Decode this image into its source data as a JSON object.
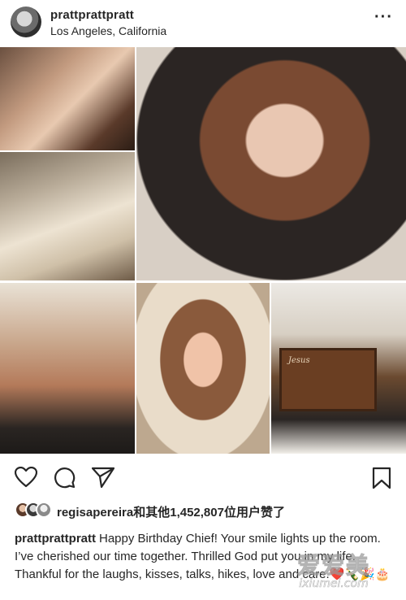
{
  "post": {
    "username": "prattprattpratt",
    "location": "Los Angeles, California",
    "more_icon": "ellipsis-icon"
  },
  "collage": {
    "placard_text": "Jesus"
  },
  "actions": {
    "like_icon": "heart-icon",
    "comment_icon": "comment-icon",
    "share_icon": "send-icon",
    "save_icon": "bookmark-icon"
  },
  "likes": {
    "text": "regisapereira和其他1,452,807位用户赞了"
  },
  "caption": {
    "username": "prattprattpratt",
    "text": "Happy Birthday Chief! Your smile lights up the room. I’ve cherished our time together. Thrilled God put you in my life. Thankful for the laughs, kisses, talks, hikes, love and care.❤️🍾🎉🎂"
  },
  "watermark": {
    "main": "爱爱美",
    "sub": "ixiumei.com"
  },
  "colors": {
    "text": "#262626",
    "background": "#ffffff"
  }
}
